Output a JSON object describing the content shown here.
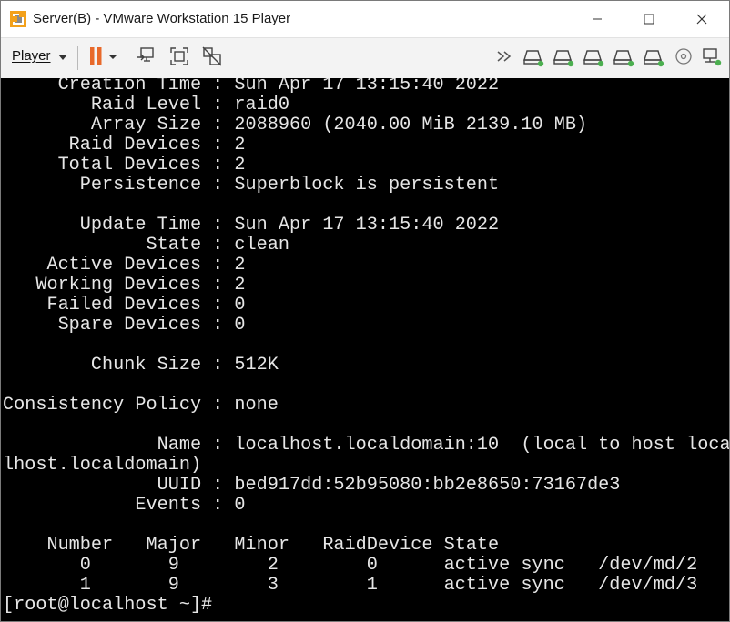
{
  "window": {
    "title": "Server(B) - VMware Workstation 15 Player",
    "app_icon": "vmware-icon",
    "controls": [
      "minimize-icon",
      "maximize-icon",
      "close-icon"
    ]
  },
  "toolbar": {
    "player_label": "Player",
    "left_icons": [
      "pause-icon",
      "send-ctrl-alt-del-icon",
      "fit-guest-icon",
      "unity-icon"
    ],
    "right_icons": [
      "more-arrows-icon",
      "hard-disk-icon",
      "hard-disk-icon",
      "hard-disk-icon",
      "hard-disk-icon",
      "hard-disk-icon",
      "cd-dvd-icon",
      "network-icon"
    ],
    "accent_color": "#e8692a",
    "status_green": "#4caf50"
  },
  "terminal": {
    "lines": [
      "     Creation Time : Sun Apr 17 13:15:40 2022",
      "        Raid Level : raid0",
      "        Array Size : 2088960 (2040.00 MiB 2139.10 MB)",
      "      Raid Devices : 2",
      "     Total Devices : 2",
      "       Persistence : Superblock is persistent",
      "",
      "       Update Time : Sun Apr 17 13:15:40 2022",
      "             State : clean",
      "    Active Devices : 2",
      "   Working Devices : 2",
      "    Failed Devices : 0",
      "     Spare Devices : 0",
      "",
      "        Chunk Size : 512K",
      "",
      "Consistency Policy : none",
      "",
      "              Name : localhost.localdomain:10  (local to host loca",
      "lhost.localdomain)",
      "              UUID : bed917dd:52b95080:bb2e8650:73167de3",
      "            Events : 0",
      "",
      "    Number   Major   Minor   RaidDevice State",
      "       0       9        2        0      active sync   /dev/md/2",
      "       1       9        3        1      active sync   /dev/md/3",
      "[root@localhost ~]#"
    ]
  }
}
